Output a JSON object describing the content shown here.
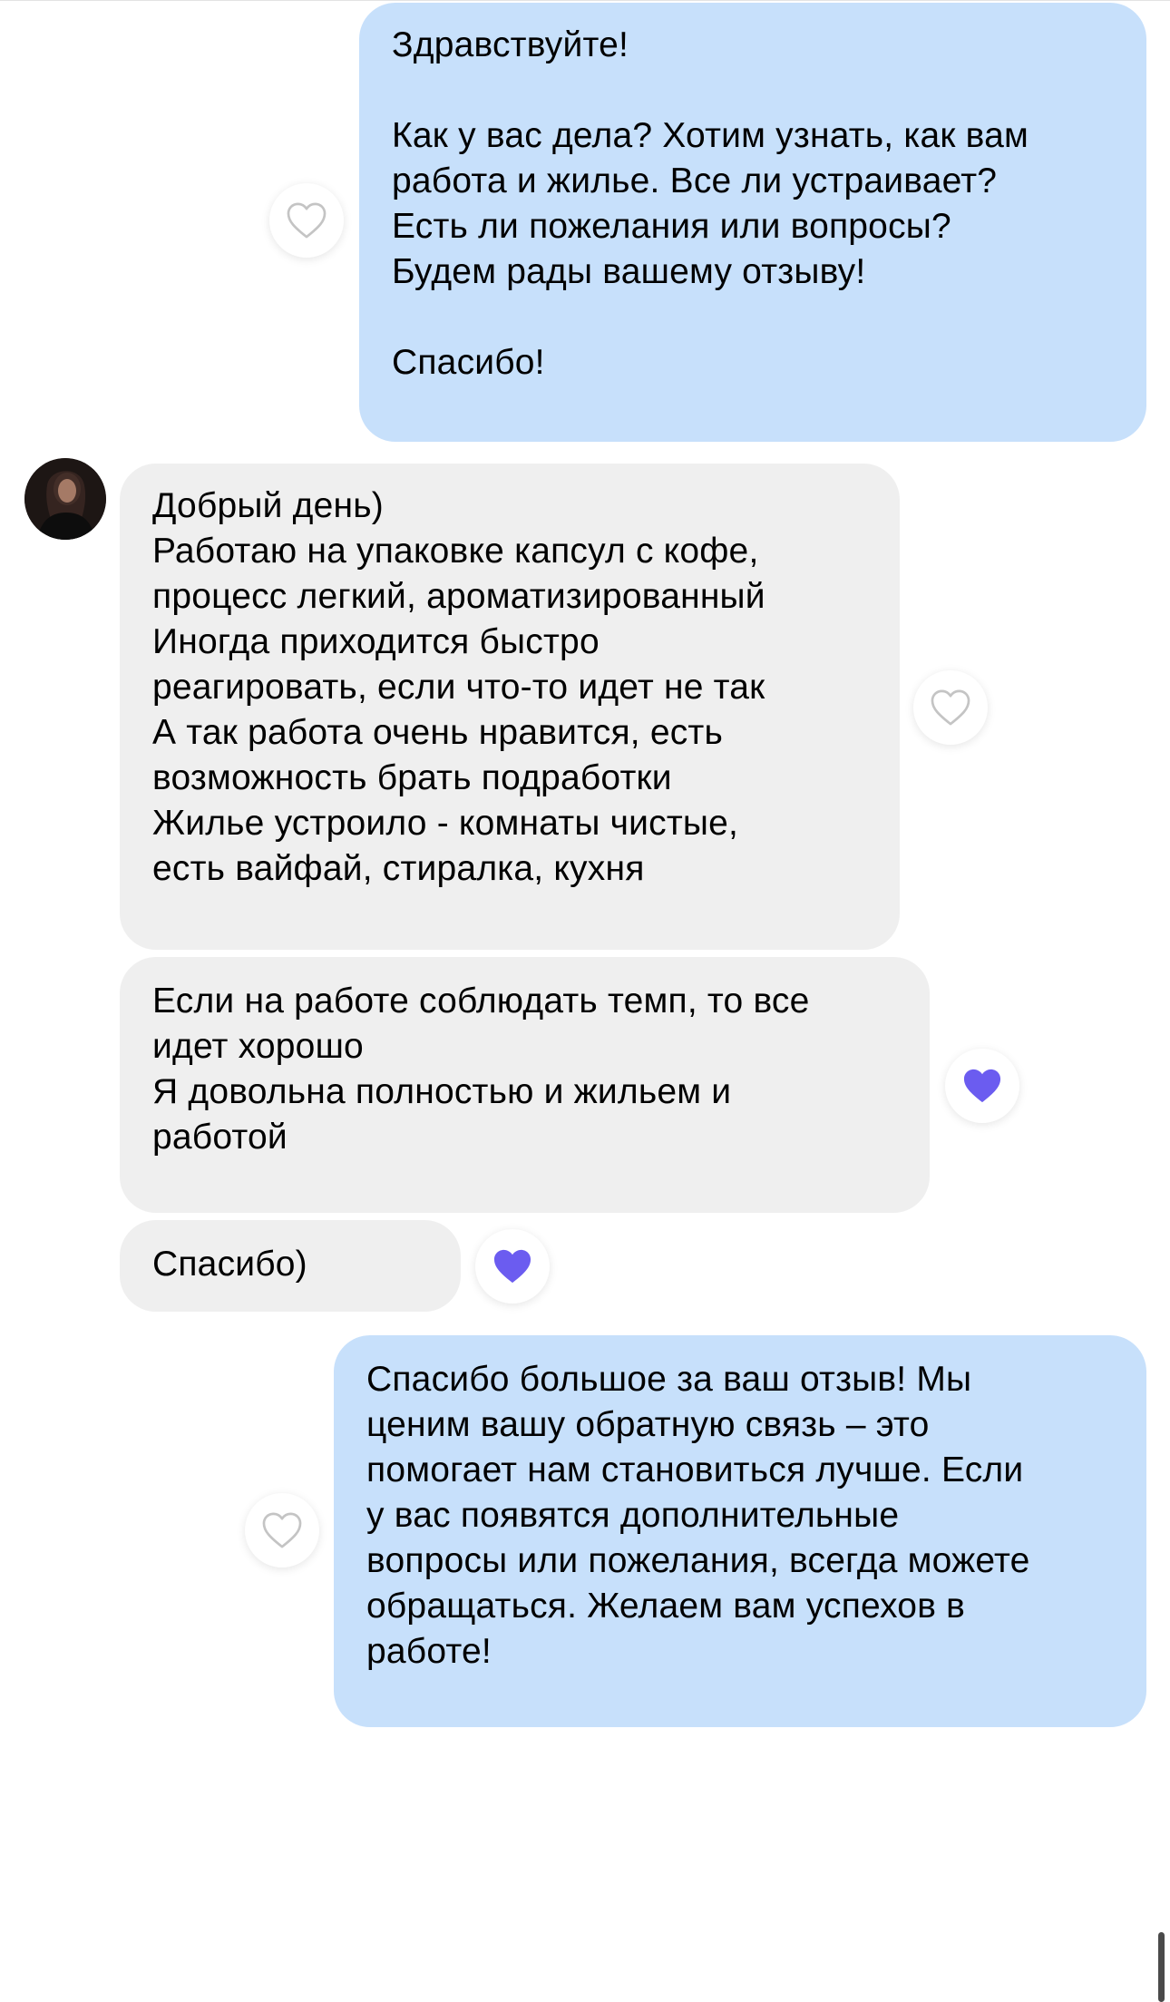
{
  "messages": [
    {
      "direction": "outgoing",
      "text": "Здравствуйте!\n\nКак у вас дела? Хотим узнать, как вам\nработа и жилье. Все ли устраивает?\nЕсть ли пожелания или вопросы?\nБудем рады вашему отзыву!\n\nСпасибо!",
      "reaction": "heart-outline"
    },
    {
      "direction": "incoming",
      "text": "Добрый день)\nРаботаю на упаковке капсул с кофе,\nпроцесс легкий, ароматизированный\nИногда приходится быстро\nреагировать, если что-то идет не так\nА так работа очень нравится, есть\nвозможность брать подработки\nЖилье устроило - комнаты чистые,\nесть вайфай, стиралка, кухня",
      "reaction": "heart-outline"
    },
    {
      "direction": "incoming",
      "text": "Если на работе соблюдать темп, то все\nидет хорошо\nЯ довольна полностью и жильем и\nработой",
      "reaction": "heart-filled"
    },
    {
      "direction": "incoming",
      "text": "Спасибо)",
      "reaction": "heart-filled"
    },
    {
      "direction": "outgoing",
      "text": "Спасибо большое за ваш отзыв! Мы\nценим вашу обратную связь – это\nпомогает нам становиться лучше. Если\nу вас появятся дополнительные\nвопросы или пожелания, всегда можете\nобращаться. Желаем вам успехов в\nработе!",
      "reaction": "heart-outline"
    }
  ],
  "colors": {
    "outgoing_bubble": "#c7e0fb",
    "incoming_bubble": "#efefef",
    "heart_filled": "#6b5cf0",
    "heart_outline": "#c4c4c4"
  },
  "icons": {
    "avatar": "user-avatar",
    "reaction_outline": "heart-outline-icon",
    "reaction_filled": "heart-filled-icon"
  }
}
